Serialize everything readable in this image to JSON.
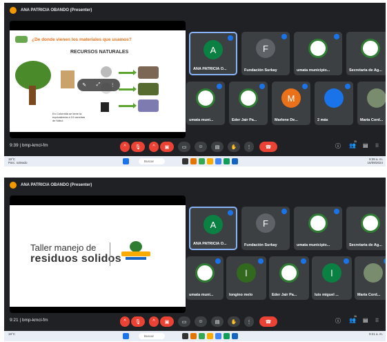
{
  "screens": [
    {
      "title": "ANA PATRICIA OBANDO (Presenter)",
      "slide": {
        "question": "¿De donde vienen los materiales que usamos?",
        "heading": "RECURSOS NATURALES",
        "caption": "En Colombia se tiene la equivalencia a 10 canchas de fútbol"
      },
      "tiles": [
        {
          "name": "ANA PATRICIA O...",
          "initial": "A",
          "avatar_color": "#0b8043",
          "active": true
        },
        {
          "name": "Fundación Surkay",
          "initial": "F",
          "avatar_color": "#5f6368"
        },
        {
          "name": "umata municipio...",
          "initial": "",
          "avatar_color": "#ffffff"
        },
        {
          "name": "Secretaria de Ag...",
          "initial": "",
          "avatar_color": "#ffffff"
        },
        {
          "name": "umata muni...",
          "initial": "",
          "avatar_color": "#ffffff"
        },
        {
          "name": "Eder Jair Pa...",
          "initial": "",
          "avatar_color": "#ffffff"
        },
        {
          "name": "Marlene De...",
          "initial": "M",
          "avatar_color": "#e8711a"
        },
        {
          "name": "2 más",
          "initial": "",
          "avatar_color": "#1a73e8"
        },
        {
          "name": "María Cord...",
          "initial": "",
          "avatar_color": "#7a8c6e"
        }
      ],
      "meeting": "9:39 | bmp-kmcl-fm",
      "participants_count": "11",
      "taskbar": {
        "weather": "19°C",
        "weather_desc": "Parc. soleado",
        "search": "Buscar",
        "clock": "9:39 a. m.",
        "date": "16/09/2024"
      }
    },
    {
      "title": "ANA PATRICIA OBANDO (Presenter)",
      "slide": {
        "line1": "Taller manejo de",
        "line2": "residuos solidos"
      },
      "tiles": [
        {
          "name": "ANA PATRICIA O...",
          "initial": "A",
          "avatar_color": "#0b8043",
          "active": true
        },
        {
          "name": "Fundación Surkay",
          "initial": "F",
          "avatar_color": "#5f6368"
        },
        {
          "name": "umata municipio...",
          "initial": "",
          "avatar_color": "#ffffff"
        },
        {
          "name": "Secretaria de Ag...",
          "initial": "",
          "avatar_color": "#ffffff"
        },
        {
          "name": "umata muni...",
          "initial": "",
          "avatar_color": "#ffffff"
        },
        {
          "name": "longino melo",
          "initial": "l",
          "avatar_color": "#33691e"
        },
        {
          "name": "Eder Jair Pa...",
          "initial": "",
          "avatar_color": "#ffffff"
        },
        {
          "name": "luis miguel ...",
          "initial": "l",
          "avatar_color": "#0b8043"
        },
        {
          "name": "María Cord...",
          "initial": "",
          "avatar_color": "#7a8c6e"
        }
      ],
      "meeting": "9:21 | bmp-kmcl-fm",
      "participants_count": "11",
      "taskbar": {
        "weather": "19°C",
        "weather_desc": "",
        "search": "Buscar",
        "clock": "9:21 a. m.",
        "date": ""
      }
    }
  ],
  "colors": {
    "end_call": "#ea4335",
    "meet_bg": "#202124",
    "tile": "#3c4043",
    "accent": "#8ab4f8"
  }
}
